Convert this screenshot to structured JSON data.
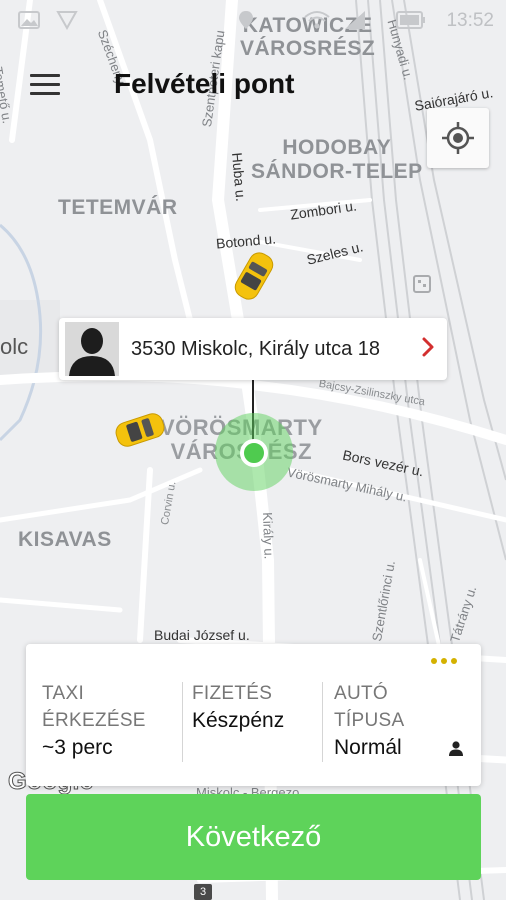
{
  "status_bar": {
    "time": "13:52"
  },
  "header": {
    "title": "Felvételi pont"
  },
  "map": {
    "districts": {
      "katowicze": "KATOWICZE\nVÁROSRÉSZ",
      "hodobay": "HODOBAY\nSÁNDOR-TELEP",
      "tetemvar": "TETEMVÁR",
      "vorosmarty": "VÖRÖSMARTY\nVÁROSRÉSZ",
      "kisavas": "KISAVAS"
    },
    "city_fragment": "olc",
    "streets": {
      "szechenyi": "Széchenyi",
      "szentpeteri_kapu": "Szentpéteri kapu",
      "sajorajaro": "Sajórajáró u.",
      "hunyadi": "Hunyadi u.",
      "temeto": "Temető u.",
      "huba": "Huba u.",
      "zombori": "Zombori u.",
      "botond": "Botond u.",
      "szeles": "Szeles u.",
      "bajcsy": "Bajcsy-Zsilinszky utca",
      "bors_vezer": "Bors vezér u.",
      "vorosmarty_mihaly": "Vörösmarty Mihály u.",
      "kiraly": "Király u.",
      "corvin": "Corvin u.",
      "budai_jozsef": "Budai József u.",
      "miskolc_bergezo": "Miskolc - Bergezo",
      "szent_lorinc": "Szentlőrinci u.",
      "tatar": "Tátrány u."
    },
    "road_number": "3",
    "google_logo": "Google"
  },
  "address_card": {
    "address": "3530 Miskolc, Király utca 18"
  },
  "info_panel": {
    "taxi_arrival_label": "TAXI\nÉRKEZÉSE",
    "taxi_arrival_value": "~3 perc",
    "payment_label": "FIZETÉS",
    "payment_value": "Készpénz",
    "car_type_label": "AUTÓ\nTÍPUSA",
    "car_type_value": "Normál"
  },
  "next_button": {
    "label": "Következő"
  },
  "colors": {
    "accent_green": "#5ed35a",
    "taxi_yellow": "#f4c20d",
    "chevron_red": "#d32f2f",
    "dots_yellow": "#d4b100"
  },
  "icons": {
    "menu": "hamburger-menu-icon",
    "locate": "crosshair-locate-icon",
    "avatar": "person-silhouette-icon",
    "chevron": "chevron-right-icon",
    "more": "more-dots-icon",
    "person": "person-icon",
    "taxi": "taxi-car-icon"
  }
}
